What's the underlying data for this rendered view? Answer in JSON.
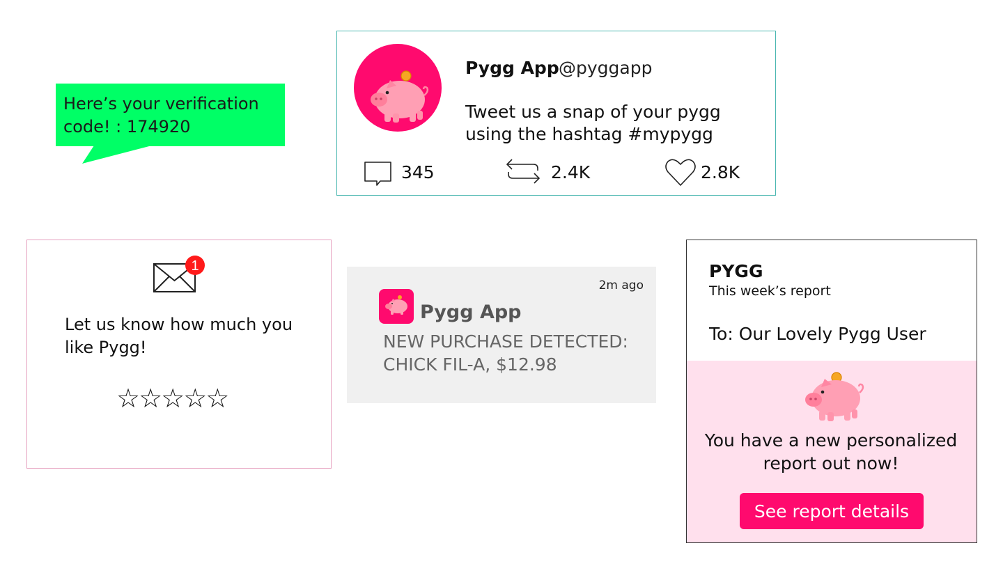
{
  "sms": {
    "text": "Here’s your verification code! : 174920"
  },
  "tweet": {
    "name": "Pygg App",
    "handle": "@pyggapp",
    "body": "Tweet us a snap of your pygg using the hashtag #mypygg",
    "replies": "345",
    "retweets": "2.4K",
    "likes": "2.8K",
    "icons": [
      "comment-icon",
      "retweet-icon",
      "heart-icon"
    ],
    "avatar_color": "#ff0a6e"
  },
  "rating": {
    "badge_count": "1",
    "prompt": "Let us know how much you like Pygg!",
    "stars": "☆☆☆☆☆",
    "border_color": "#e6a0bf"
  },
  "push": {
    "time": "2m ago",
    "app_name": "Pygg App",
    "message": "NEW PURCHASE DETECTED: CHICK FIL-A, $12.98"
  },
  "report": {
    "brand": "PYGG",
    "subtitle": "This week’s report",
    "to_line": "To: Our Lovely Pygg User",
    "message": "You have a new personalized report out now!",
    "button_label": "See report details",
    "accent_color": "#ff0a6e",
    "panel_color": "#ffe0ed"
  }
}
